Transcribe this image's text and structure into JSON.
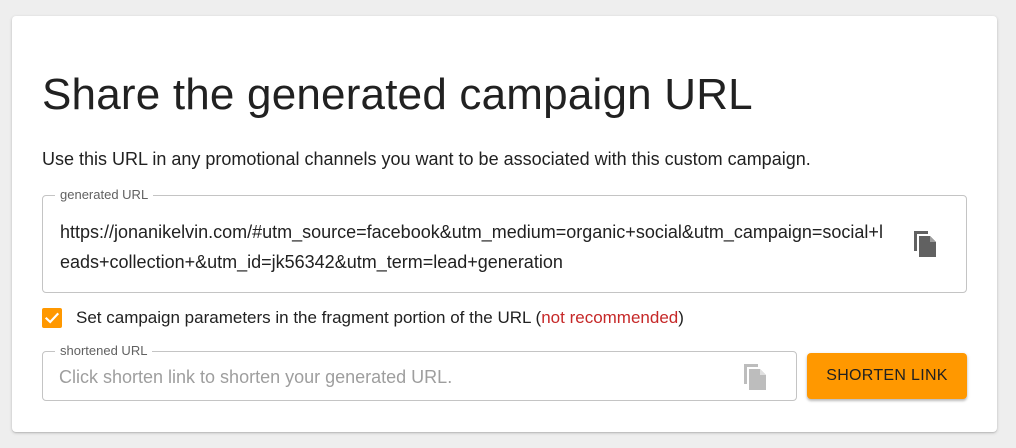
{
  "card": {
    "title": "Share the generated campaign URL",
    "description": "Use this URL in any promotional channels you want to be associated with this custom campaign."
  },
  "generated_url": {
    "label": "generated URL",
    "value": "https://jonanikelvin.com/#utm_source=facebook&utm_medium=organic+social&utm_campaign=social+leads+collection+&utm_id=jk56342&utm_term=lead+generation",
    "copy_icon": "copy-icon"
  },
  "fragment_option": {
    "checked": true,
    "label_text": "Set campaign parameters in the fragment portion of the URL (",
    "warning": "not recommended",
    "label_suffix": ")"
  },
  "shortened_url": {
    "label": "shortened URL",
    "value": "",
    "placeholder": "Click shorten link to shorten your generated URL.",
    "copy_icon": "copy-icon"
  },
  "actions": {
    "shorten_label": "SHORTEN LINK"
  },
  "colors": {
    "accent": "#ff9800",
    "warning": "#c62828",
    "icon_active": "#616161",
    "icon_disabled": "#bdbdbd"
  }
}
